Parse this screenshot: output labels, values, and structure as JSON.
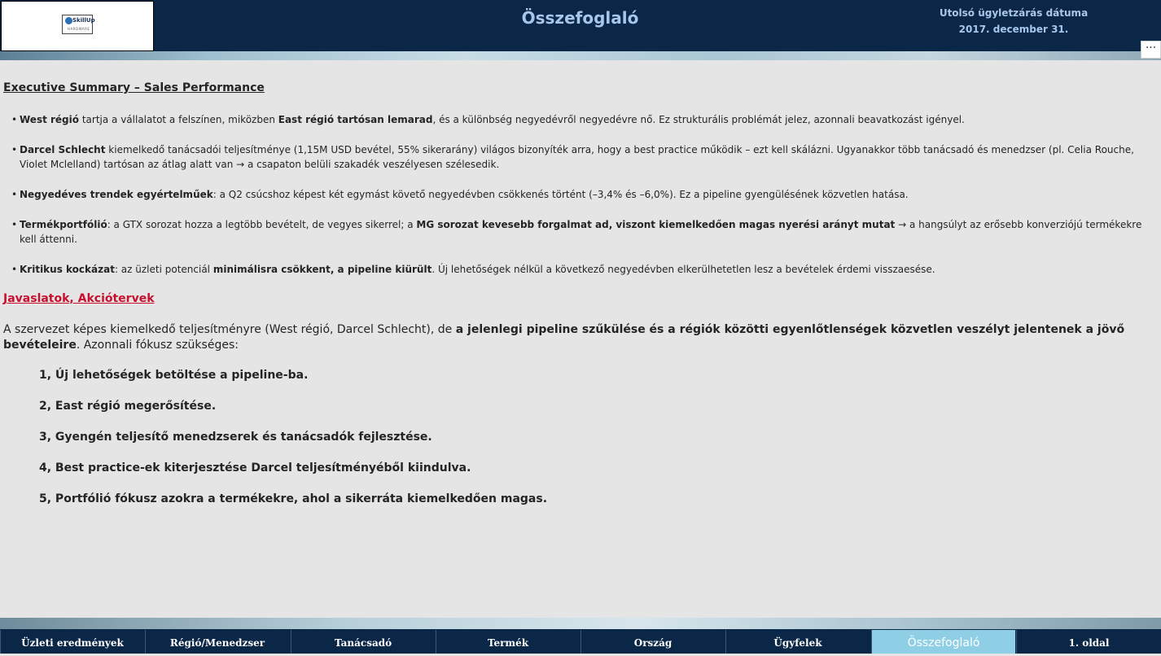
{
  "header": {
    "title": "Összefoglaló",
    "last_transaction_label": "Utolsó ügyletzárás dátuma",
    "last_transaction_date": "2017. december 31.",
    "logo_text": "SkillUp",
    "logo_sub": "HARDWARE"
  },
  "menu": {
    "more_label": "···"
  },
  "summary": {
    "heading": "Executive Summary – Sales Performance",
    "bullets": [
      [
        {
          "t": "West régió",
          "b": true
        },
        {
          "t": " tartja a vállalatot a felszínen, miközben ",
          "b": false
        },
        {
          "t": "East régió tartósan lemarad",
          "b": true
        },
        {
          "t": ", és a különbség negyedévről negyedévre nő. Ez strukturális problémát jelez, azonnali beavatkozást igényel.",
          "b": false
        }
      ],
      [
        {
          "t": "Darcel Schlecht",
          "b": true
        },
        {
          "t": " kiemelkedő tanácsadói teljesítménye (1,15M USD bevétel, 55% sikerarány) világos bizonyíték arra, hogy a best practice működik – ezt kell skálázni. Ugyanakkor több tanácsadó és menedzser (pl. Celia Rouche, Violet Mclelland) tartósan az átlag alatt van → a csapaton belüli szakadék veszélyesen szélesedik.",
          "b": false
        }
      ],
      [
        {
          "t": "Negyedéves trendek egyértelműek",
          "b": true
        },
        {
          "t": ": a Q2 csúcshoz képest két egymást követő negyedévben csökkenés történt (–3,4% és –6,0%). Ez a pipeline gyengülésének közvetlen hatása.",
          "b": false
        }
      ],
      [
        {
          "t": "Termékportfólió",
          "b": true
        },
        {
          "t": ": a GTX sorozat hozza a legtöbb bevételt, de vegyes sikerrel; a ",
          "b": false
        },
        {
          "t": "MG sorozat kevesebb forgalmat ad, viszont kiemelkedően magas nyerési arányt mutat",
          "b": true
        },
        {
          "t": " → a hangsúlyt az erősebb konverziójú termékekre kell áttenni.",
          "b": false
        }
      ],
      [
        {
          "t": "Kritikus kockázat",
          "b": true
        },
        {
          "t": ": az üzleti potenciál ",
          "b": false
        },
        {
          "t": "minimálisra csökkent, a pipeline kiürült",
          "b": true
        },
        {
          "t": ". Új lehetőségek nélkül a következő negyedévben elkerülhetetlen lesz a bevételek érdemi visszaesése.",
          "b": false
        }
      ]
    ]
  },
  "actions": {
    "heading": "Javaslatok, Akciótervek",
    "intro": [
      {
        "t": "A szervezet képes kiemelkedő teljesítményre (West régió, Darcel Schlecht), de ",
        "b": false
      },
      {
        "t": "a jelenlegi pipeline szűkülése és a régiók közötti egyenlőtlenségek közvetlen veszélyt jelentenek a jövő bevételeire",
        "b": true
      },
      {
        "t": ". Azonnali fókusz szükséges:",
        "b": false
      }
    ],
    "items": [
      "1, Új lehetőségek betöltése a pipeline-ba.",
      "2, East régió megerősítése.",
      "3, Gyengén teljesítő menedzserek és tanácsadók fejlesztése.",
      "4, Best practice-ek kiterjesztése Darcel teljesítményéből kiindulva.",
      "5, Portfólió fókusz azokra a termékekre, ahol a sikerráta kiemelkedően magas."
    ]
  },
  "nav": {
    "tabs": [
      {
        "label": "Üzleti eredmények",
        "active": false
      },
      {
        "label": "Régió/Menedzser",
        "active": false
      },
      {
        "label": "Tanácsadó",
        "active": false
      },
      {
        "label": "Termék",
        "active": false
      },
      {
        "label": "Ország",
        "active": false
      },
      {
        "label": "Ügyfelek",
        "active": false
      },
      {
        "label": "Összefoglaló",
        "active": true
      },
      {
        "label": "1. oldal",
        "active": false
      }
    ]
  },
  "colors": {
    "header_bg": "#0b2748",
    "title_color": "#a8c6ea",
    "action_heading": "#c8102e",
    "active_tab": "#8ecfe6",
    "page_bg": "#e5e5e5"
  }
}
